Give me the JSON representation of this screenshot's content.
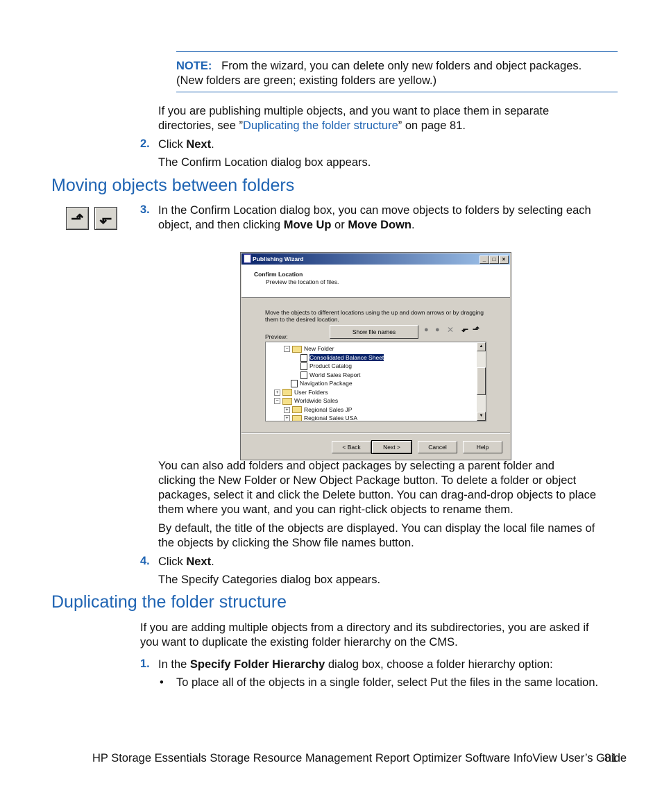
{
  "note": {
    "label": "NOTE:",
    "text": "From the wizard, you can delete only new folders and object packages.",
    "text2": "(New folders are green; existing folders are yellow.)"
  },
  "intro": {
    "line1": "If you are publishing multiple objects, and you want to place them in separate",
    "line2_pre": "directories, see ”",
    "line2_link": "Duplicating the folder structure",
    "line2_post": "” on page 81."
  },
  "step2": {
    "num": "2.",
    "pre": "Click ",
    "bold": "Next",
    "post": ".",
    "result": "The Confirm Location dialog box appears."
  },
  "section1": {
    "title": "Moving objects between folders"
  },
  "icons": {
    "move_up": "move-up-icon",
    "move_down": "move-down-icon"
  },
  "step3": {
    "num": "3.",
    "line1": "In the Confirm Location dialog box, you can move objects to folders by selecting each",
    "line2_pre": "object, and then clicking ",
    "bold1": "Move Up",
    "mid": " or ",
    "bold2": "Move Down",
    "post": "."
  },
  "dialog": {
    "title": "Publishing Wizard",
    "header": "Confirm Location",
    "subheader": "Preview the location of files.",
    "instructions1": "Move the objects to different locations using the up and down arrows or by dragging",
    "instructions2": "them to the desired location.",
    "show_file_names": "Show file names",
    "preview_label": "Preview:",
    "tree": [
      {
        "label": "New Folder",
        "type": "folder",
        "level": 2,
        "expander": "-"
      },
      {
        "label": "Consolidated Balance Sheet",
        "type": "doc",
        "level": 3,
        "selected": true
      },
      {
        "label": "Product Catalog",
        "type": "doc",
        "level": 3
      },
      {
        "label": "World Sales Report",
        "type": "doc",
        "level": 3
      },
      {
        "label": "Navigation Package",
        "type": "package",
        "level": 2
      },
      {
        "label": "User Folders",
        "type": "folder",
        "level": 1,
        "expander": "+"
      },
      {
        "label": "Worldwide Sales",
        "type": "folder",
        "level": 1,
        "expander": "-"
      },
      {
        "label": "Regional Sales JP",
        "type": "folder",
        "level": 2,
        "expander": "+"
      },
      {
        "label": "Regional Sales USA",
        "type": "folder",
        "level": 2,
        "expander": "+"
      }
    ],
    "back": "< Back",
    "next": "Next >",
    "cancel": "Cancel",
    "help": "Help"
  },
  "para1": [
    "You can also add folders and object packages by selecting a parent folder and",
    "clicking the New Folder or New Object Package button. To delete a folder or object",
    "packages, select it and click the Delete button. You can drag-and-drop objects to place",
    "them where you want, and you can right-click objects to rename them."
  ],
  "para2": [
    "By default, the title of the objects are displayed. You can display the local file names of",
    "the objects by clicking the Show file names button."
  ],
  "step4": {
    "num": "4.",
    "pre": "Click ",
    "bold": "Next",
    "post": ".",
    "result": "The Specify Categories dialog box appears."
  },
  "section2": {
    "title": "Duplicating the folder structure"
  },
  "para3": [
    "If you are adding multiple objects from a directory and its subdirectories, you are asked if",
    "you want to duplicate the existing folder hierarchy on the CMS."
  ],
  "step1": {
    "num": "1.",
    "pre": "In the ",
    "bold": "Specify Folder Hierarchy",
    "post": " dialog box, choose a folder hierarchy option:"
  },
  "bullet": {
    "mark": "•",
    "text": "To place all of the objects in a single folder, select Put the files in the same location."
  },
  "footer": {
    "text": "HP Storage Essentials Storage Resource Management Report Optimizer Software InfoView User’s Guide",
    "page": "81"
  }
}
